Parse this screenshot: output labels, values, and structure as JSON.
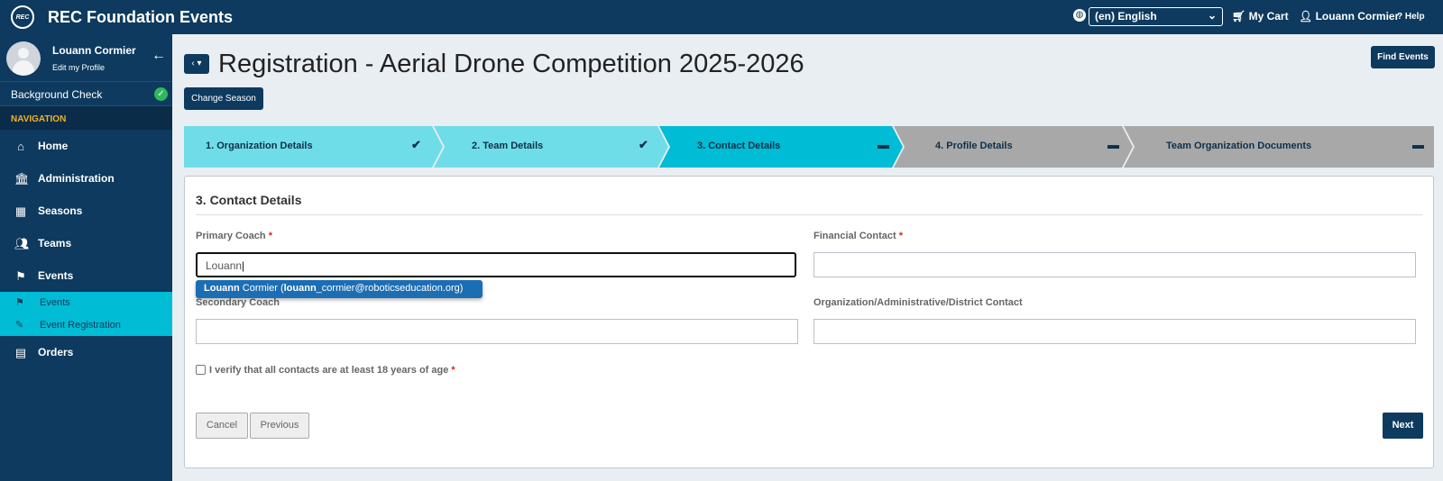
{
  "app": {
    "title": "REC Foundation Events",
    "logo_text": "REC"
  },
  "topbar": {
    "language": "(en) English",
    "cart": "My Cart",
    "user": "Louann Cormier",
    "help": "Help"
  },
  "sidebar": {
    "profile_name": "Louann Cormier",
    "edit_profile": "Edit my Profile",
    "background_check": "Background Check",
    "nav_heading": "NAVIGATION",
    "items": [
      {
        "label": "Home",
        "icon": "home-icon"
      },
      {
        "label": "Administration",
        "icon": "institution-icon"
      },
      {
        "label": "Seasons",
        "icon": "calendar-icon"
      },
      {
        "label": "Teams",
        "icon": "users-icon"
      },
      {
        "label": "Events",
        "icon": "flag-icon"
      }
    ],
    "subitems": [
      {
        "label": "Events",
        "icon": "flag-icon"
      },
      {
        "label": "Event Registration",
        "icon": "edit-icon"
      }
    ],
    "orders": {
      "label": "Orders",
      "icon": "briefcase-icon"
    }
  },
  "page": {
    "title": "Registration - Aerial Drone Competition 2025-2026",
    "change_season": "Change Season",
    "find_events": "Find Events"
  },
  "steps": [
    {
      "label": "1. Organization Details",
      "status": "complete"
    },
    {
      "label": "2. Team Details",
      "status": "complete"
    },
    {
      "label": "3. Contact Details",
      "status": "active"
    },
    {
      "label": "4. Profile Details",
      "status": "pending"
    },
    {
      "label": "Team Organization Documents",
      "status": "pending"
    }
  ],
  "form": {
    "section_title": "3. Contact Details",
    "primary_coach_label": "Primary Coach",
    "primary_coach_value": "Louann",
    "suggestion": {
      "match1": "Louann",
      "rest1": " Cormier (",
      "match2": "louann",
      "rest2": "_cormier@roboticseducation.org)"
    },
    "secondary_coach_label": "Secondary Coach",
    "financial_contact_label": "Financial Contact",
    "org_contact_label": "Organization/Administrative/District Contact",
    "required_mark": "*",
    "verify_label": "I verify that all contacts are at least 18 years of age",
    "cancel": "Cancel",
    "previous": "Previous",
    "next": "Next"
  },
  "colors": {
    "navy": "#0d3a5e",
    "step_complete": "#6fdde8",
    "step_active": "#00bcd4",
    "step_pending": "#a8a8a8"
  }
}
